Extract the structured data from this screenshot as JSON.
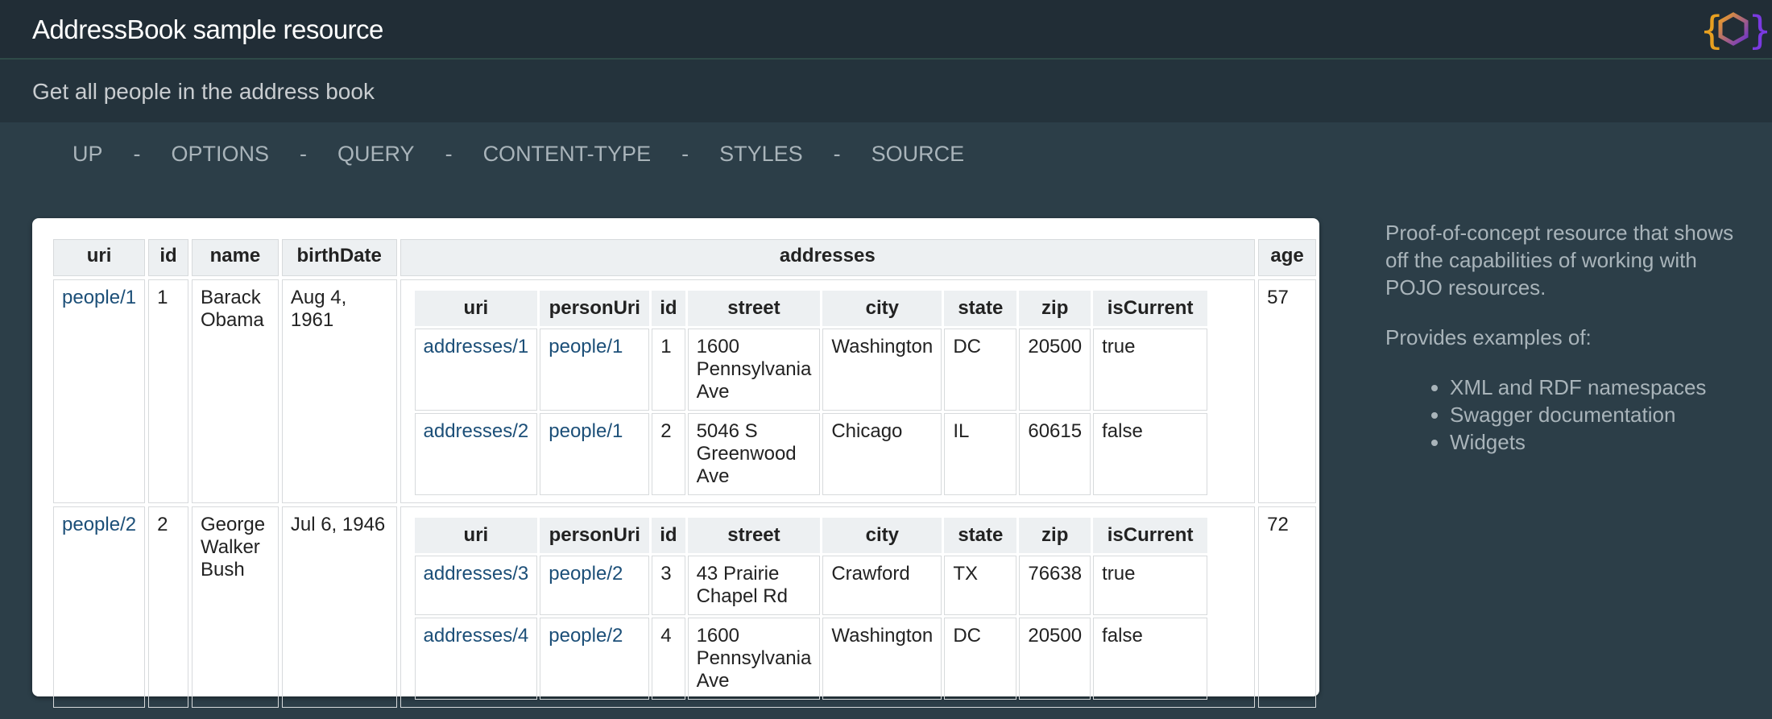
{
  "header": {
    "title": "AddressBook sample resource"
  },
  "subheader": {
    "text": "Get all people in the address book"
  },
  "nav": {
    "items": [
      "UP",
      "OPTIONS",
      "QUERY",
      "CONTENT-TYPE",
      "STYLES",
      "SOURCE"
    ],
    "separator": "-"
  },
  "table": {
    "columns": [
      "uri",
      "id",
      "name",
      "birthDate",
      "addresses",
      "age"
    ],
    "address_columns": [
      "uri",
      "personUri",
      "id",
      "street",
      "city",
      "state",
      "zip",
      "isCurrent"
    ],
    "people": [
      {
        "uri": "people/1",
        "id": "1",
        "name": "Barack Obama",
        "birthDate": "Aug 4, 1961",
        "age": "57",
        "addresses": [
          {
            "uri": "addresses/1",
            "personUri": "people/1",
            "id": "1",
            "street": "1600 Pennsylvania Ave",
            "city": "Washington",
            "state": "DC",
            "zip": "20500",
            "isCurrent": "true"
          },
          {
            "uri": "addresses/2",
            "personUri": "people/1",
            "id": "2",
            "street": "5046 S Greenwood Ave",
            "city": "Chicago",
            "state": "IL",
            "zip": "60615",
            "isCurrent": "false"
          }
        ]
      },
      {
        "uri": "people/2",
        "id": "2",
        "name": "George Walker Bush",
        "birthDate": "Jul 6, 1946",
        "age": "72",
        "addresses": [
          {
            "uri": "addresses/3",
            "personUri": "people/2",
            "id": "3",
            "street": "43 Prairie Chapel Rd",
            "city": "Crawford",
            "state": "TX",
            "zip": "76638",
            "isCurrent": "true"
          },
          {
            "uri": "addresses/4",
            "personUri": "people/2",
            "id": "4",
            "street": "1600 Pennsylvania Ave",
            "city": "Washington",
            "state": "DC",
            "zip": "20500",
            "isCurrent": "false"
          }
        ]
      }
    ]
  },
  "sidebar": {
    "description": "Proof-of-concept resource that shows off the capabilities of working with POJO resources.",
    "examples_heading": "Provides examples of:",
    "examples": [
      "XML and RDF namespaces",
      "Swagger documentation",
      "Widgets"
    ]
  },
  "colors": {
    "background": "#2c3e48",
    "header": "#212d36",
    "link": "#1c4f78",
    "logo_orange": "#f0a020",
    "logo_purple": "#6a2fd0"
  },
  "logo_icon": "juneau-hexagon-logo-icon"
}
